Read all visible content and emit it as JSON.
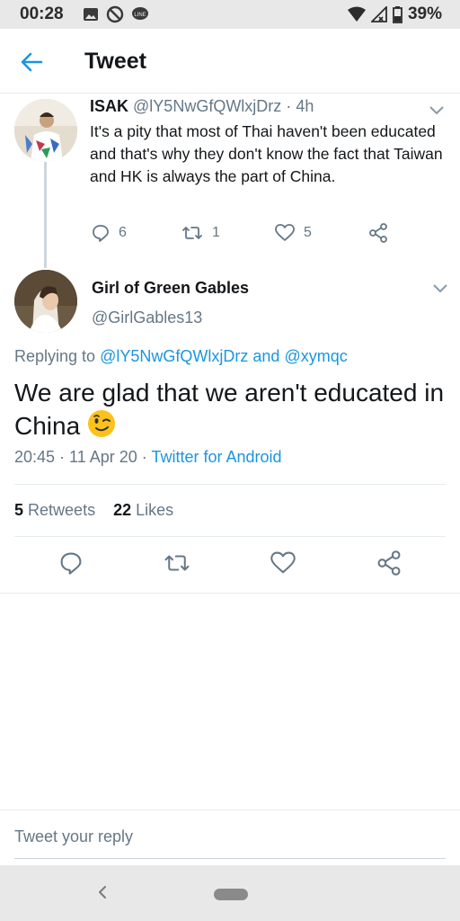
{
  "status_bar": {
    "time": "00:28",
    "battery": "39%"
  },
  "header": {
    "title": "Tweet"
  },
  "parent_tweet": {
    "name": "ISAK",
    "handle": "@lY5NwGfQWlxjDrz",
    "time": "· 4h",
    "text": "It's a pity that most of Thai haven't been educated and that's why they don't know the fact that Taiwan and HK is always the part of China.",
    "replies": "6",
    "retweets": "1",
    "likes": "5"
  },
  "main_tweet": {
    "name": "Girl of Green Gables",
    "handle": "@GirlGables13",
    "replying_prefix": "Replying to",
    "replying_user1": "@lY5NwGfQWlxjDrz",
    "replying_and": "and",
    "replying_user2": "@xymqc",
    "text": "We are glad that we aren't educated in China",
    "emoji": "winking-face",
    "timestamp": "20:45 · 11 Apr 20 ·",
    "source": "Twitter for Android",
    "retweet_count": "5",
    "retweet_label": "Retweets",
    "like_count": "22",
    "like_label": "Likes"
  },
  "reply": {
    "placeholder": "Tweet your reply"
  },
  "colors": {
    "accent": "#1b95e0",
    "muted": "#657786",
    "text": "#14171a"
  }
}
